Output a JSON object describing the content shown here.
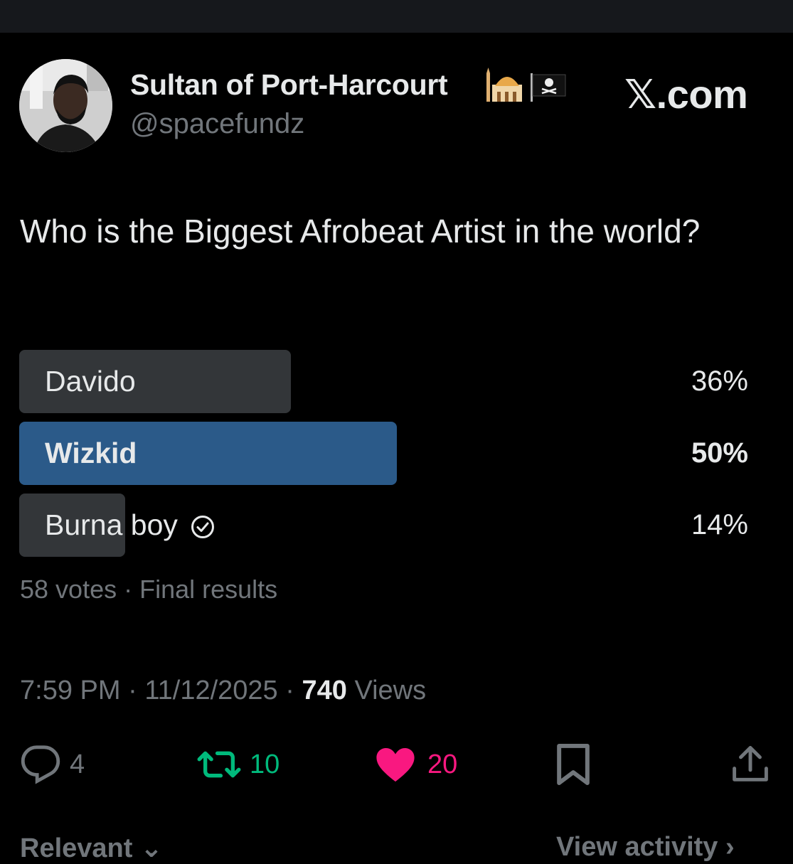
{
  "author": {
    "display_name": "Sultan of Port-Harcourt",
    "handle": "@spacefundz",
    "emoji_icons": [
      "mosque-emoji-icon",
      "pirate-flag-emoji-icon"
    ]
  },
  "brand": {
    "label": "𝕏.com"
  },
  "tweet": {
    "text": "Who is the Biggest Afrobeat Artist in the world?"
  },
  "poll": {
    "options": [
      {
        "label": "Davido",
        "percent_label": "36%",
        "percent": 36,
        "winner": false
      },
      {
        "label": "Wizkid",
        "percent_label": "50%",
        "percent": 50,
        "winner": true
      },
      {
        "label": "Burna boy",
        "percent_label": "14%",
        "percent": 14,
        "winner": false,
        "voted": true
      }
    ],
    "meta": "58 votes · Final results"
  },
  "metadata": {
    "time": "7:59 PM",
    "date": "11/12/2025",
    "views_count": "740",
    "views_label": "Views"
  },
  "actions": {
    "replies": "4",
    "reposts": "10",
    "likes": "20",
    "colors": {
      "repost": "#00ba7c",
      "like": "#f91880",
      "muted": "#71767b"
    }
  },
  "footer": {
    "sort_label": "Relevant",
    "activity_label": "View activity"
  },
  "colors": {
    "poll_winner": "#2b5a89",
    "poll_other": "#333639",
    "background": "#000000"
  }
}
